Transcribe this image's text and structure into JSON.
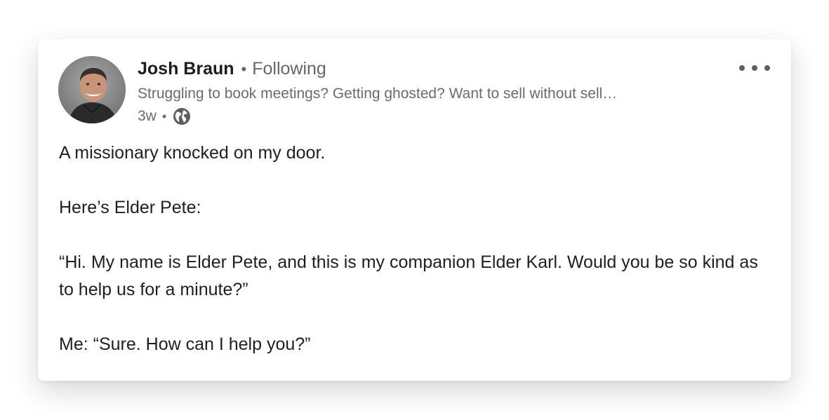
{
  "post": {
    "author": {
      "name": "Josh Braun",
      "follow_status": "Following",
      "headline": "Struggling to book meetings? Getting ghosted? Want to sell without sell…",
      "avatar_icon": "profile-photo"
    },
    "timestamp": "3w",
    "visibility_icon": "globe-icon",
    "menu_icon": "more-options-icon",
    "paragraphs": [
      "A missionary knocked on my door.",
      "Here’s Elder Pete:",
      "“Hi. My name is Elder Pete, and this is my companion Elder Karl. Would you be so kind as to help us for a minute?”",
      "Me: “Sure. How can I help you?”"
    ]
  },
  "colors": {
    "name": "#1d1d1d",
    "secondary_text": "#666666",
    "body_text": "#1f1f1f",
    "card_background": "#ffffff"
  }
}
